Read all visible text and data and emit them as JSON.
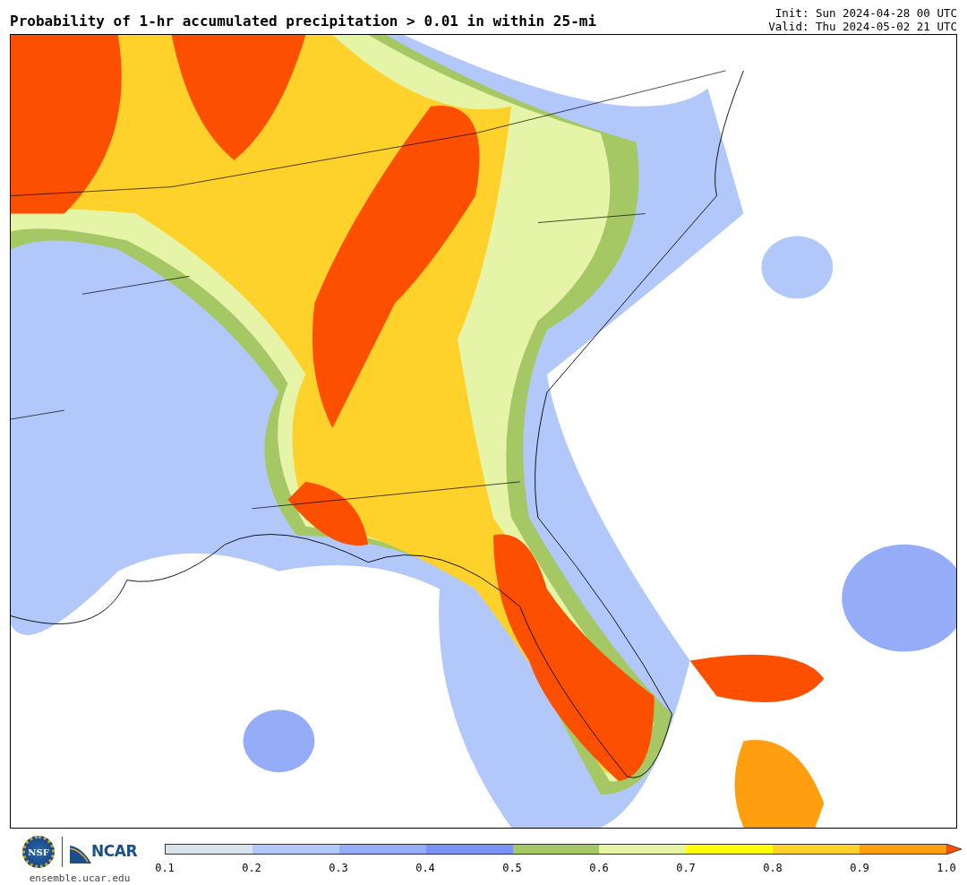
{
  "header": {
    "title": "Probability of 1-hr accumulated precipitation > 0.01 in within 25-mi",
    "init": "Init: Sun 2024-04-28 00 UTC",
    "valid": "Valid: Thu 2024-05-02 21 UTC"
  },
  "footer": {
    "nsf_logo": "NSF",
    "ncar_logo": "NCAR",
    "site": "ensemble.ucar.edu"
  },
  "colorbar": {
    "bins": [
      {
        "color": "#d9e3ec"
      },
      {
        "color": "#b3c8fa"
      },
      {
        "color": "#95acf8"
      },
      {
        "color": "#7b92f8"
      },
      {
        "color": "#a5c865"
      },
      {
        "color": "#e6f4a8"
      },
      {
        "color": "#ffff00"
      },
      {
        "color": "#fed22a"
      },
      {
        "color": "#ff9f0f"
      }
    ],
    "extend": {
      "color": "#fd4f00"
    },
    "ticks": [
      "0.1",
      "0.2",
      "0.3",
      "0.4",
      "0.5",
      "0.6",
      "0.7",
      "0.8",
      "0.9",
      "1.0"
    ]
  }
}
